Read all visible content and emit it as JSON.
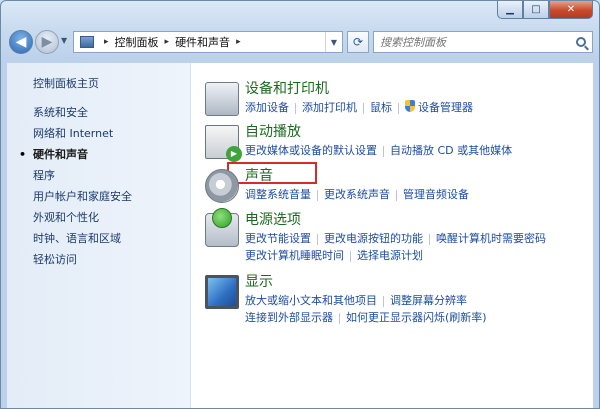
{
  "window": {
    "controls": {
      "minimize": "▁",
      "maximize": "□",
      "close": "✕"
    }
  },
  "navigation": {
    "back_icon": "arrow-left-icon",
    "forward_icon": "arrow-right-icon",
    "breadcrumb": [
      "控制面板",
      "硬件和声音"
    ],
    "search_placeholder": "搜索控制面板"
  },
  "sidebar": {
    "home": "控制面板主页",
    "items": [
      "系统和安全",
      "网络和 Internet",
      "硬件和声音",
      "程序",
      "用户帐户和家庭安全",
      "外观和个性化",
      "时钟、语言和区域",
      "轻松访问"
    ],
    "active_index": 2
  },
  "categories": {
    "devices": {
      "title": "设备和打印机",
      "links": [
        "添加设备",
        "添加打印机",
        "鼠标",
        "设备管理器"
      ]
    },
    "autoplay": {
      "title": "自动播放",
      "links": [
        "更改媒体或设备的默认设置",
        "自动播放 CD 或其他媒体"
      ]
    },
    "sound": {
      "title": "声音",
      "links": [
        "调整系统音量",
        "更改系统声音",
        "管理音频设备"
      ]
    },
    "power": {
      "title": "电源选项",
      "links": [
        "更改节能设置",
        "更改电源按钮的功能",
        "唤醒计算机时需要密码",
        "更改计算机睡眠时间",
        "选择电源计划"
      ]
    },
    "display": {
      "title": "显示",
      "links": [
        "放大或缩小文本和其他项目",
        "调整屏幕分辨率",
        "连接到外部显示器",
        "如何更正显示器闪烁(刷新率)"
      ]
    }
  },
  "colors": {
    "highlight": "#d62b2b",
    "category_title": "#1b6b1f",
    "link": "#1e4da0"
  }
}
